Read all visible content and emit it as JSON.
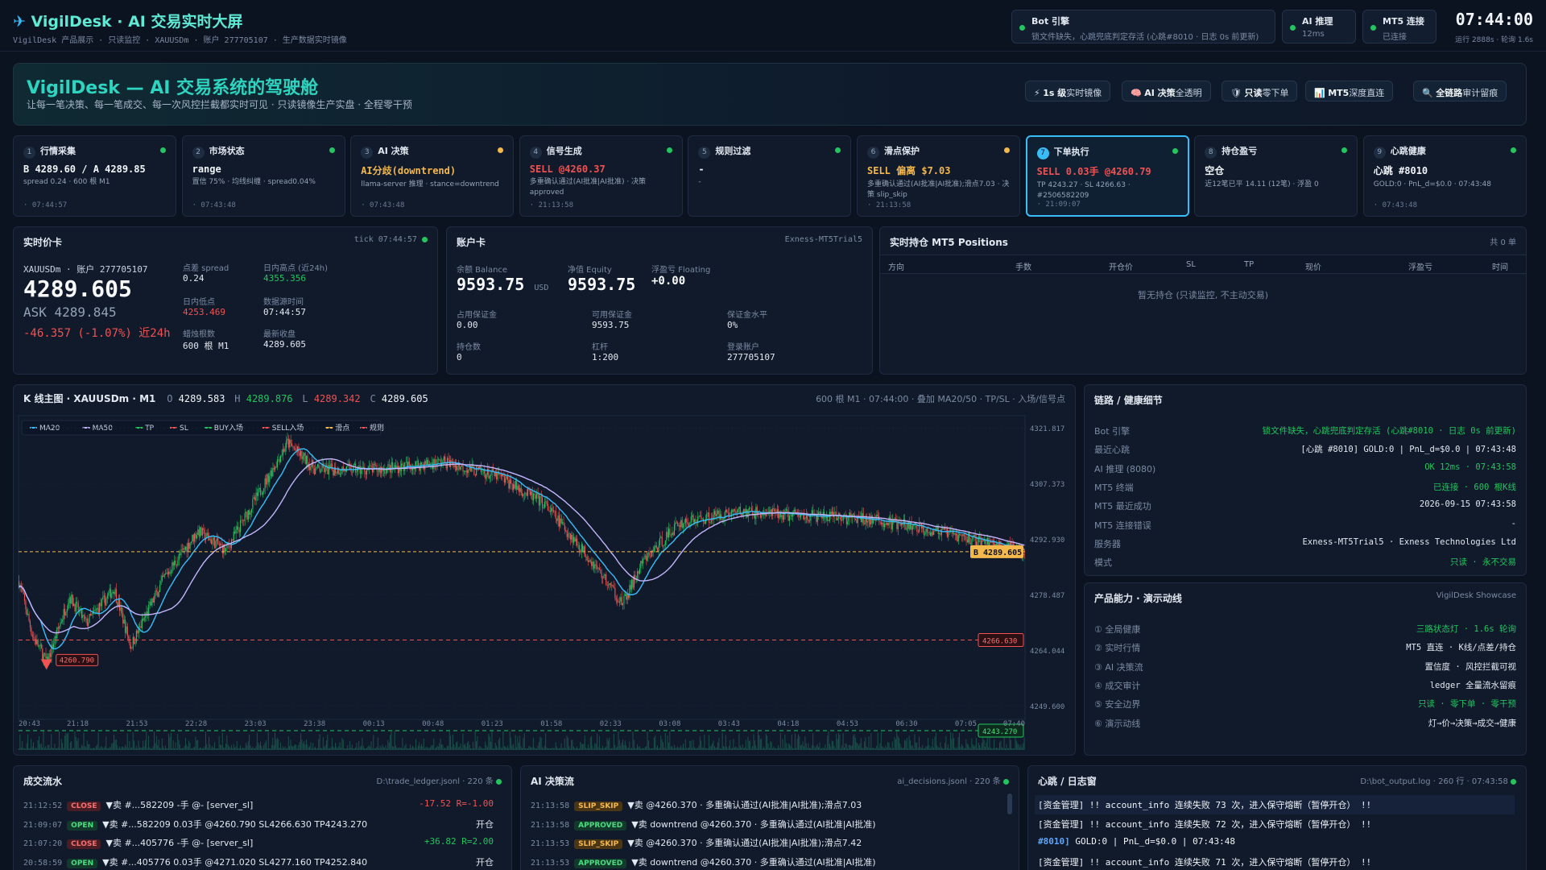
{
  "header": {
    "brand": "VigilDesk · AI 交易实时大屏",
    "subtitle": "VigilDesk 产品展示 · 只读监控 · XAUUSDm · 账户 277705107 · 生产数据实时镜像",
    "status": [
      {
        "title": "Bot 引擎",
        "detail": "锁文件缺失，心跳兜底判定存活 (心跳#8010 · 日志 0s 前更新)",
        "color": "#22c55e"
      },
      {
        "title": "AI 推理",
        "detail": "12ms",
        "color": "#22c55e"
      },
      {
        "title": "MT5 连接",
        "detail": "已连接",
        "color": "#22c55e"
      }
    ],
    "clock": "07:44:00",
    "clock_sub": "运行 2888s · 轮询 1.6s"
  },
  "hero": {
    "title": "VigilDesk — AI 交易系统的驾驶舱",
    "subtitle": "让每一笔决策、每一笔成交、每一次风控拦截都实时可见 · 只读镜像生产实盘 · 全程零干预",
    "chips": [
      {
        "icon": "⚡",
        "strong": "1s 级",
        "text": "实时镜像"
      },
      {
        "icon": "🧠",
        "strong": "AI 决策",
        "text": "全透明"
      },
      {
        "icon": "🛡",
        "strong": "只读",
        "text": "零下单"
      },
      {
        "icon": "📊",
        "strong": "MT5",
        "text": "深度直连"
      },
      {
        "icon": "🔍",
        "strong": "全链路",
        "text": "审计留痕"
      }
    ]
  },
  "pipeline": [
    {
      "n": "1",
      "name": "行情采集",
      "value": "B 4289.60 / A 4289.85",
      "vcolor": "#f1f5f9",
      "detail": "spread 0.24 · 600 根 M1",
      "time": "· 07:44:57",
      "dot": "#22c55e"
    },
    {
      "n": "2",
      "name": "市场状态",
      "value": "range",
      "vcolor": "#f1f5f9",
      "detail": "置信 75% · 均线纠缠 · spread0.04%",
      "time": "· 07:43:48",
      "dot": "#22c55e"
    },
    {
      "n": "3",
      "name": "AI 决策",
      "value": "AI分歧(downtrend)",
      "vcolor": "#f5b84c",
      "detail": "llama-server 推理 · stance=downtrend",
      "time": "· 07:43:48",
      "dot": "#f5b84c"
    },
    {
      "n": "4",
      "name": "信号生成",
      "value": "SELL @4260.37",
      "vcolor": "#f05252",
      "detail": "多重确认通过(AI批准|AI批准) · 决策 approved",
      "time": "· 21:13:58",
      "dot": "#22c55e"
    },
    {
      "n": "5",
      "name": "规则过滤",
      "value": "-",
      "vcolor": "#f1f5f9",
      "detail": "-",
      "time": "",
      "dot": "#22c55e"
    },
    {
      "n": "6",
      "name": "滑点保护",
      "value": "SELL 偏离 $7.03",
      "vcolor": "#f5b84c",
      "detail": "多重确认通过(AI批准|AI批准);滑点7.03 · 决策 slip_skip",
      "time": "· 21:13:58",
      "dot": "#f5b84c"
    },
    {
      "n": "7",
      "name": "下单执行",
      "value": "SELL 0.03手 @4260.79",
      "vcolor": "#f05252",
      "detail": "TP 4243.27 · SL 4266.63 · #2506582209",
      "time": "· 21:09:07",
      "dot": "#22c55e",
      "active": true
    },
    {
      "n": "8",
      "name": "持仓盈亏",
      "value": "空仓",
      "vcolor": "#f1f5f9",
      "detail": "近12笔已平 14.11 (12笔) · 浮盈 0",
      "time": "",
      "dot": "#22c55e"
    },
    {
      "n": "9",
      "name": "心跳健康",
      "value": "心跳 #8010",
      "vcolor": "#f1f5f9",
      "detail": "GOLD:0 · PnL_d=$0.0 · 07:43:48",
      "time": "· 07:43:48",
      "dot": "#22c55e"
    }
  ],
  "price": {
    "title": "实时价卡",
    "meta": "tick 07:44:57",
    "sym": "XAUUSDm · 账户 277705107",
    "bid": "4289.605",
    "ask": "ASK 4289.845",
    "chg": "-46.357 (-1.07%) 近24h",
    "kv": [
      {
        "k": "点差 spread",
        "v": "0.24",
        "c": "#e2e8f0"
      },
      {
        "k": "日内高点 (近24h)",
        "v": "4355.356",
        "c": "#22c55e"
      },
      {
        "k": "日内低点",
        "v": "4253.469",
        "c": "#f05252"
      },
      {
        "k": "数据源时间",
        "v": "07:44:57",
        "c": "#e2e8f0"
      },
      {
        "k": "蜡烛根数",
        "v": "600 根 M1",
        "c": "#e2e8f0"
      },
      {
        "k": "最新收盘",
        "v": "4289.605",
        "c": "#e2e8f0"
      }
    ]
  },
  "account": {
    "title": "账户卡",
    "meta": "Exness-MT5Trial5",
    "big": [
      {
        "k": "余额 Balance",
        "v": "9593.75",
        "u": "USD"
      },
      {
        "k": "净值 Equity",
        "v": "9593.75",
        "u": ""
      },
      {
        "k": "浮盈亏 Floating",
        "v": "+0.00",
        "u": ""
      }
    ],
    "kv": [
      {
        "k": "占用保证金",
        "v": "0.00"
      },
      {
        "k": "可用保证金",
        "v": "9593.75"
      },
      {
        "k": "保证金水平",
        "v": "0%"
      },
      {
        "k": "持仓数",
        "v": "0"
      },
      {
        "k": "杠杆",
        "v": "1:200"
      },
      {
        "k": "登录账户",
        "v": "277705107"
      }
    ]
  },
  "positions": {
    "title": "实时持仓 MT5 Positions",
    "meta": "共 0 单",
    "cols": [
      "方向",
      "手数",
      "开仓价",
      "SL",
      "TP",
      "现价",
      "浮盈亏",
      "时间"
    ],
    "empty": "暂无持仓 (只读监控, 不主动交易)"
  },
  "chart": {
    "title": "K 线主图 · XAUUSDm · M1",
    "o": "4289.583",
    "h": "4289.876",
    "l": "4289.342",
    "c": "4289.605",
    "meta": "600 根 M1 · 07:44:00 · 叠加 MA20/50 · TP/SL · 入场/信号点",
    "legend": [
      {
        "n": "MA20",
        "c": "#38bdf8"
      },
      {
        "n": "MA50",
        "c": "#c4b5fd"
      },
      {
        "n": "TP",
        "c": "#22c55e"
      },
      {
        "n": "SL",
        "c": "#f05252"
      },
      {
        "n": "BUY入场",
        "c": "#22c55e"
      },
      {
        "n": "SELL入场",
        "c": "#f05252"
      },
      {
        "n": "滑点",
        "c": "#f5b84c"
      },
      {
        "n": "规则",
        "c": "#f05252"
      }
    ]
  },
  "chart_data": {
    "type": "candlestick",
    "ylim": [
      4246,
      4325
    ],
    "yticks": [
      "4321.817",
      "4307.373",
      "4292.930",
      "4278.487",
      "4264.044",
      "4249.600"
    ],
    "xticks": [
      "20:43",
      "21:18",
      "21:53",
      "22:28",
      "23:03",
      "23:38",
      "00:13",
      "00:48",
      "01:23",
      "01:58",
      "02:33",
      "03:08",
      "03:43",
      "04:18",
      "04:53",
      "06:30",
      "07:05",
      "07:40"
    ],
    "anchors": [
      [
        0,
        4282
      ],
      [
        12,
        4268
      ],
      [
        25,
        4260.8
      ],
      [
        45,
        4278
      ],
      [
        60,
        4271
      ],
      [
        85,
        4280
      ],
      [
        100,
        4265
      ],
      [
        130,
        4283
      ],
      [
        160,
        4295
      ],
      [
        185,
        4290
      ],
      [
        215,
        4305
      ],
      [
        240,
        4318
      ],
      [
        265,
        4311
      ],
      [
        320,
        4311
      ],
      [
        380,
        4313
      ],
      [
        430,
        4309
      ],
      [
        470,
        4302
      ],
      [
        510,
        4288
      ],
      [
        540,
        4276
      ],
      [
        558,
        4287
      ],
      [
        590,
        4297
      ],
      [
        640,
        4300
      ],
      [
        700,
        4299
      ],
      [
        760,
        4298
      ],
      [
        820,
        4295
      ],
      [
        880,
        4291
      ],
      [
        900,
        4289.6
      ]
    ],
    "bid_line": "B 4289.605",
    "sl": "4266.630",
    "tp": "4243.270",
    "sell_entry": "4260.790"
  },
  "health": {
    "title": "链路 / 健康细节",
    "rows": [
      {
        "k": "Bot 引擎",
        "v": "锁文件缺失，心跳兜底判定存活 (心跳#8010 · 日志 0s 前更新)",
        "c": "#22c55e"
      },
      {
        "k": "最近心跳",
        "v": "[心跳 #8010] GOLD:0 | PnL_d=$0.0 | 07:43:48",
        "c": "#e2e8f0"
      },
      {
        "k": "AI 推理 (8080)",
        "v": "OK 12ms · 07:43:58",
        "c": "#22c55e"
      },
      {
        "k": "MT5 终端",
        "v": "已连接 · 600 根K线",
        "c": "#22c55e"
      },
      {
        "k": "MT5 最近成功",
        "v": "2026-09-15 07:43:58",
        "c": "#e2e8f0"
      },
      {
        "k": "MT5 连接错误",
        "v": "-",
        "c": "#e2e8f0"
      },
      {
        "k": "服务器",
        "v": "Exness-MT5Trial5 · Exness Technologies Ltd",
        "c": "#e2e8f0"
      },
      {
        "k": "模式",
        "v": "只读 · 永不交易",
        "c": "#22c55e"
      }
    ]
  },
  "showcase": {
    "title": "产品能力 · 演示动线",
    "meta": "VigilDesk Showcase",
    "rows": [
      {
        "k": "① 全局健康",
        "v": "三路状态灯 · 1.6s 轮询",
        "c": "#22c55e"
      },
      {
        "k": "② 实时行情",
        "v": "MT5 直连 · K线/点差/持仓",
        "c": "#e2e8f0"
      },
      {
        "k": "③ AI 决策流",
        "v": "置信度 · 风控拦截可视",
        "c": "#e2e8f0"
      },
      {
        "k": "④ 成交审计",
        "v": "ledger 全量流水留痕",
        "c": "#e2e8f0"
      },
      {
        "k": "⑤ 安全边界",
        "v": "只读 · 零下单 · 零干预",
        "c": "#22c55e"
      },
      {
        "k": "⑥ 演示动线",
        "v": "灯→价→决策→成交→健康",
        "c": "#e2e8f0"
      }
    ]
  },
  "trades": {
    "title": "成交流水",
    "meta": "D:\\trade_ledger.jsonl · 220 条",
    "rows": [
      {
        "t": "21:12:52",
        "tag": "CLOSE",
        "d": "▼卖 #...582209 -手 @- [server_sl]",
        "p": "-17.52 R=-1.00",
        "pc": "#f05252"
      },
      {
        "t": "21:09:07",
        "tag": "OPEN",
        "d": "▼卖 #...582209 0.03手 @4260.790 SL4266.630 TP4243.270",
        "p": "开仓",
        "pc": "#e2e8f0"
      },
      {
        "t": "21:07:20",
        "tag": "CLOSE",
        "d": "▼卖 #...405776 -手 @- [server_sl]",
        "p": "+36.82 R=2.00",
        "pc": "#22c55e"
      },
      {
        "t": "20:58:59",
        "tag": "OPEN",
        "d": "▼卖 #...405776 0.03手 @4271.020 SL4277.160 TP4252.840",
        "p": "开仓",
        "pc": "#e2e8f0"
      }
    ]
  },
  "decisions": {
    "title": "AI 决策流",
    "meta": "ai_decisions.jsonl · 220 条",
    "rows": [
      {
        "t": "21:13:58",
        "tag": "SLIP_SKIP",
        "d": "▼卖 @4260.370 · 多重确认通过(AI批准|AI批准);滑点7.03"
      },
      {
        "t": "21:13:58",
        "tag": "APPROVED",
        "d": "▼卖 downtrend @4260.370 · 多重确认通过(AI批准|AI批准)"
      },
      {
        "t": "21:13:53",
        "tag": "SLIP_SKIP",
        "d": "▼卖 @4260.370 · 多重确认通过(AI批准|AI批准);滑点7.42"
      },
      {
        "t": "21:13:53",
        "tag": "APPROVED",
        "d": "▼卖 downtrend @4260.370 · 多重确认通过(AI批准|AI批准)"
      }
    ]
  },
  "log": {
    "title": "心跳 / 日志窗",
    "meta": "D:\\bot_output.log · 260 行 · 07:43:58",
    "rows": [
      {
        "pre": "",
        "text": "[资金管理] !! account_info 连续失败 73 次，进入保守熔断（暂停开仓） !!"
      },
      {
        "pre": "",
        "text": "[资金管理] !! account_info 连续失败 72 次，进入保守熔断（暂停开仓） !!"
      },
      {
        "pre": "#8010]",
        "text": " GOLD:0 | PnL_d=$0.0 | 07:43:48"
      },
      {
        "pre": "",
        "text": "[资金管理] !! account_info 连续失败 71 次，进入保守熔断（暂停开仓） !!"
      }
    ]
  }
}
